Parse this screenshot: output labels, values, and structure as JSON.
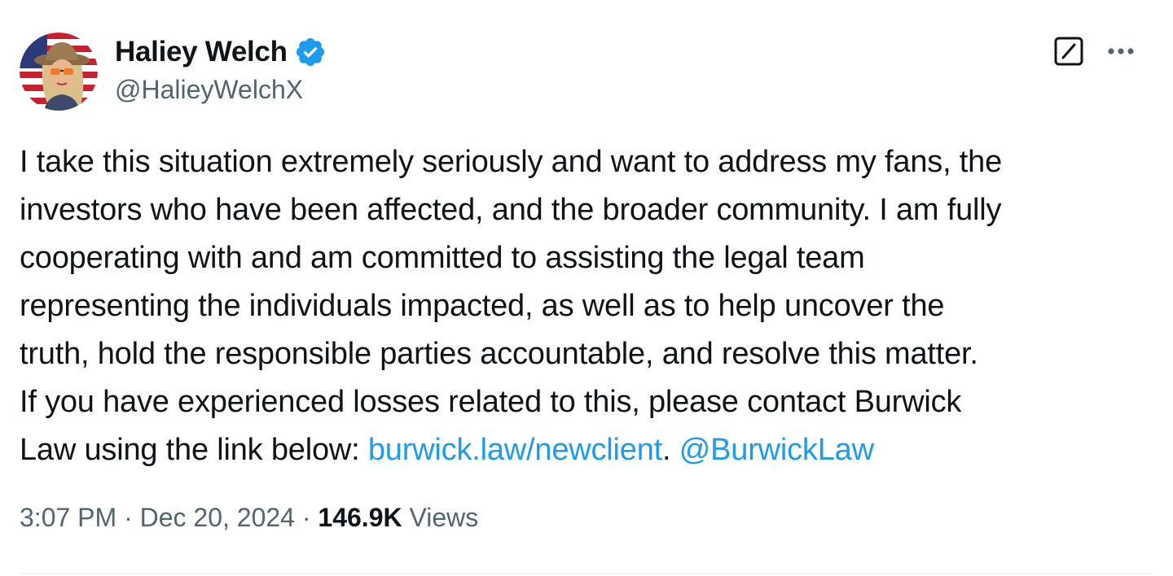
{
  "author": {
    "display_name": "Haliey Welch",
    "handle": "@HalieyWelchX",
    "verified": true,
    "verified_color": "#1d9bf0",
    "avatar_icon": "profile-photo"
  },
  "actions": {
    "grok_icon": "grok-slash-box-icon",
    "more_icon": "ellipsis-icon"
  },
  "tweet": {
    "text_lines": [
      "I take this situation extremely seriously and want to address my fans, the",
      "investors who have been affected, and the broader community. I am fully",
      "cooperating with and am committed to assisting the legal team",
      "representing the individuals impacted, as well as to help uncover the",
      "truth, hold the responsible parties accountable, and resolve this matter.",
      "If you have experienced losses related to this, please contact Burwick"
    ],
    "last_line_prefix": "Law using the link below: ",
    "link_url_text": "burwick.law/newclient",
    "link_separator": ". ",
    "mention": "@BurwickLaw",
    "link_color": "#1d9bf0"
  },
  "meta": {
    "time": "3:07 PM",
    "separator": " · ",
    "date": "Dec 20, 2024",
    "views_count": "146.9K",
    "views_label": " Views"
  }
}
